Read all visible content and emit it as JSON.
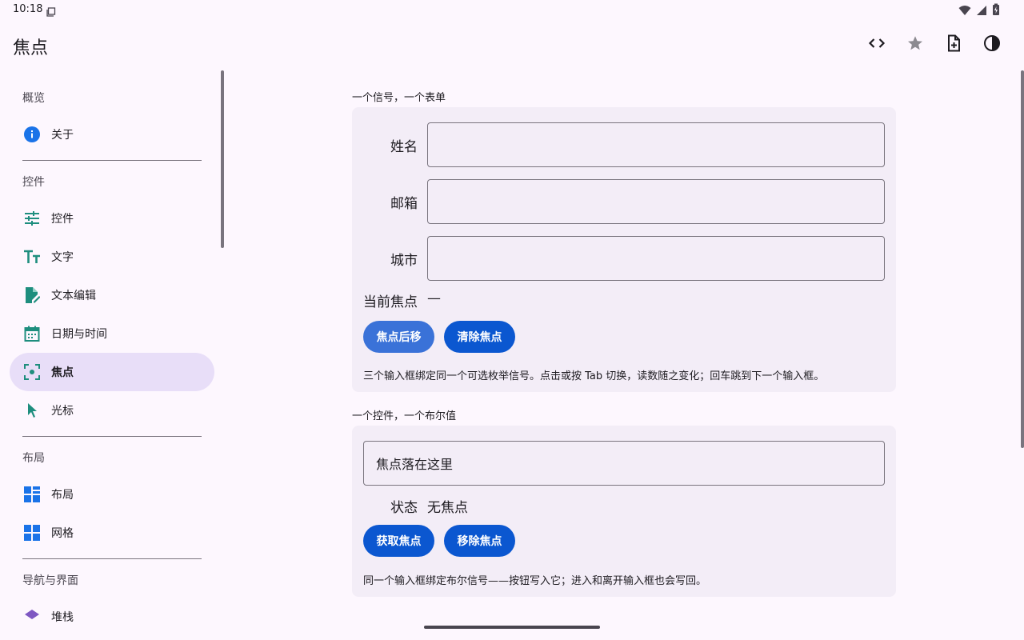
{
  "status_bar": {
    "time": "10:18"
  },
  "app_bar": {
    "title": "焦点",
    "actions": [
      "code-icon",
      "star-icon",
      "add-document-icon",
      "contrast-icon"
    ]
  },
  "sidebar": {
    "sections": [
      {
        "header": "概览",
        "items": [
          {
            "label": "关于",
            "icon": "info-icon"
          }
        ]
      },
      {
        "header": "控件",
        "items": [
          {
            "label": "控件",
            "icon": "tune-icon"
          },
          {
            "label": "文字",
            "icon": "text-size-icon"
          },
          {
            "label": "文本编辑",
            "icon": "edit-document-icon"
          },
          {
            "label": "日期与时间",
            "icon": "calendar-icon"
          },
          {
            "label": "焦点",
            "icon": "focus-icon",
            "active": true
          },
          {
            "label": "光标",
            "icon": "cursor-icon"
          }
        ]
      },
      {
        "header": "布局",
        "items": [
          {
            "label": "布局",
            "icon": "layout-grid-icon"
          },
          {
            "label": "网格",
            "icon": "grid-icon"
          }
        ]
      },
      {
        "header": "导航与界面",
        "items": [
          {
            "label": "堆栈",
            "icon": "stack-icon"
          }
        ]
      }
    ]
  },
  "form_section": {
    "caption": "一个信号，一个表单",
    "fields": [
      {
        "label": "姓名",
        "value": ""
      },
      {
        "label": "邮箱",
        "value": ""
      },
      {
        "label": "城市",
        "value": ""
      }
    ],
    "current_focus_label": "当前焦点",
    "current_focus_value": "—",
    "buttons": [
      "焦点后移",
      "清除焦点"
    ],
    "helper": "三个输入框绑定同一个可选枚举信号。点击或按 Tab 切换，读数随之变化；回车跳到下一个输入框。"
  },
  "bool_section": {
    "caption": "一个控件，一个布尔值",
    "input_value": "焦点落在这里",
    "state_label": "状态",
    "state_value": "无焦点",
    "buttons": [
      "获取焦点",
      "移除焦点"
    ],
    "helper": "同一个输入框绑定布尔信号——按钮写入它；进入和离开输入框也会写回。"
  },
  "colors": {
    "background": "#fdf7fe",
    "card": "#f3edf7",
    "active_nav": "#e8def8",
    "primary_button": "#0b57d0",
    "primary_button_light": "#3a72d8",
    "teal_icon": "#1e8e7e",
    "blue_icon": "#1a73e8"
  }
}
